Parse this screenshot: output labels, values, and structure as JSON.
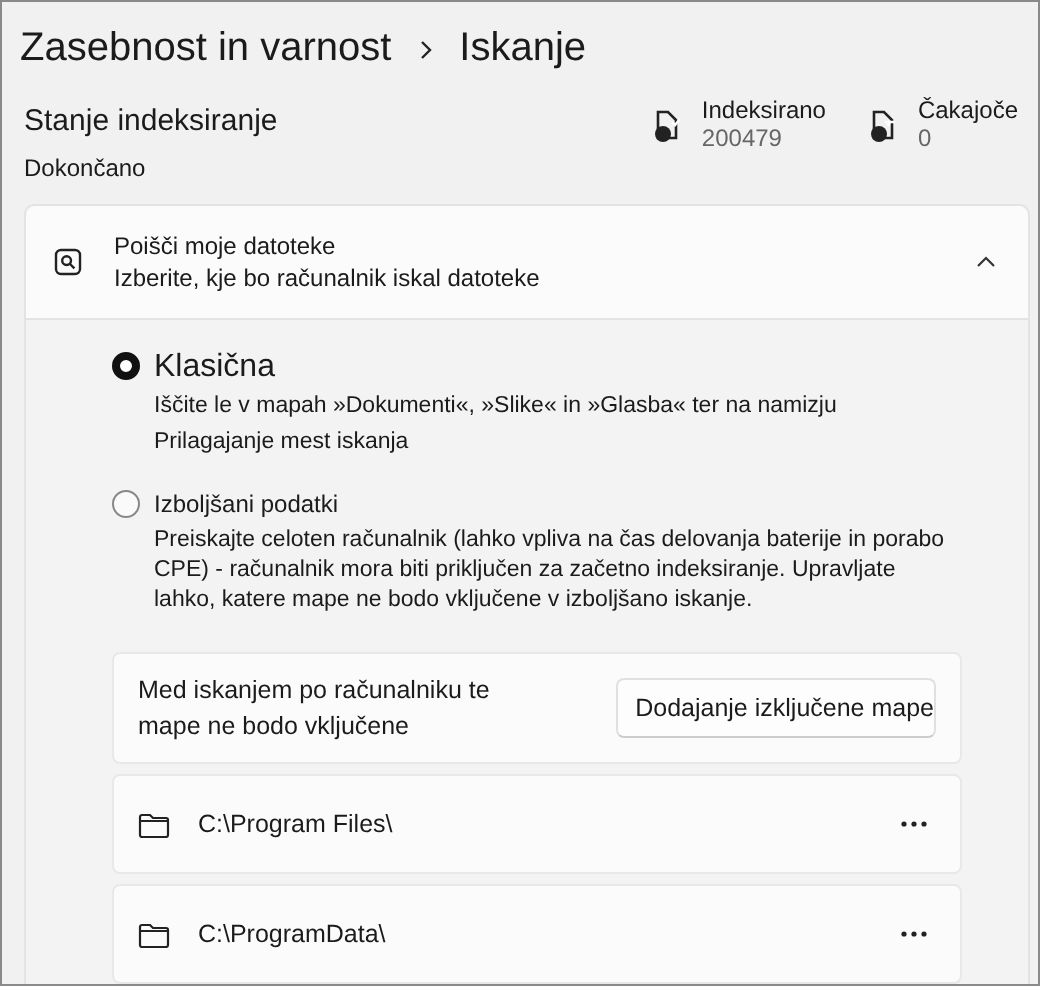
{
  "breadcrumb": [
    {
      "label": "Zasebnost in varnost"
    },
    {
      "label": "Iskanje"
    }
  ],
  "status": {
    "title": "Stanje indeksiranje",
    "value": "Dokončano"
  },
  "stats": [
    {
      "kind": "done",
      "label": "Indeksirano",
      "value": "200479"
    },
    {
      "kind": "pending",
      "label": "Čakajoče",
      "value": "0"
    }
  ],
  "expander": {
    "title": "Poišči moje datoteke",
    "subtitle": "Izberite, kje bo računalnik iskal datoteke",
    "expanded": true,
    "options": [
      {
        "label": "Klasična",
        "selected": true,
        "description": "Iščite le v mapah »Dokumenti«, »Slike« in »Glasba« ter na namizju",
        "link": "Prilagajanje mest iskanja"
      },
      {
        "label": "Izboljšani podatki",
        "selected": false,
        "description": "Preiskajte celoten računalnik (lahko vpliva na čas delovanja baterije in porabo CPE) - računalnik mora biti priključen za začetno indeksiranje. Upravljate lahko, katere mape ne bodo vključene v izboljšano iskanje."
      }
    ],
    "excluded": {
      "text": "Med iskanjem po računalniku te mape ne bodo vključene",
      "button": "Dodajanje izključene mape",
      "folders": [
        {
          "path": "C:\\Program Files\\"
        },
        {
          "path": "C:\\ProgramData\\"
        }
      ]
    }
  }
}
